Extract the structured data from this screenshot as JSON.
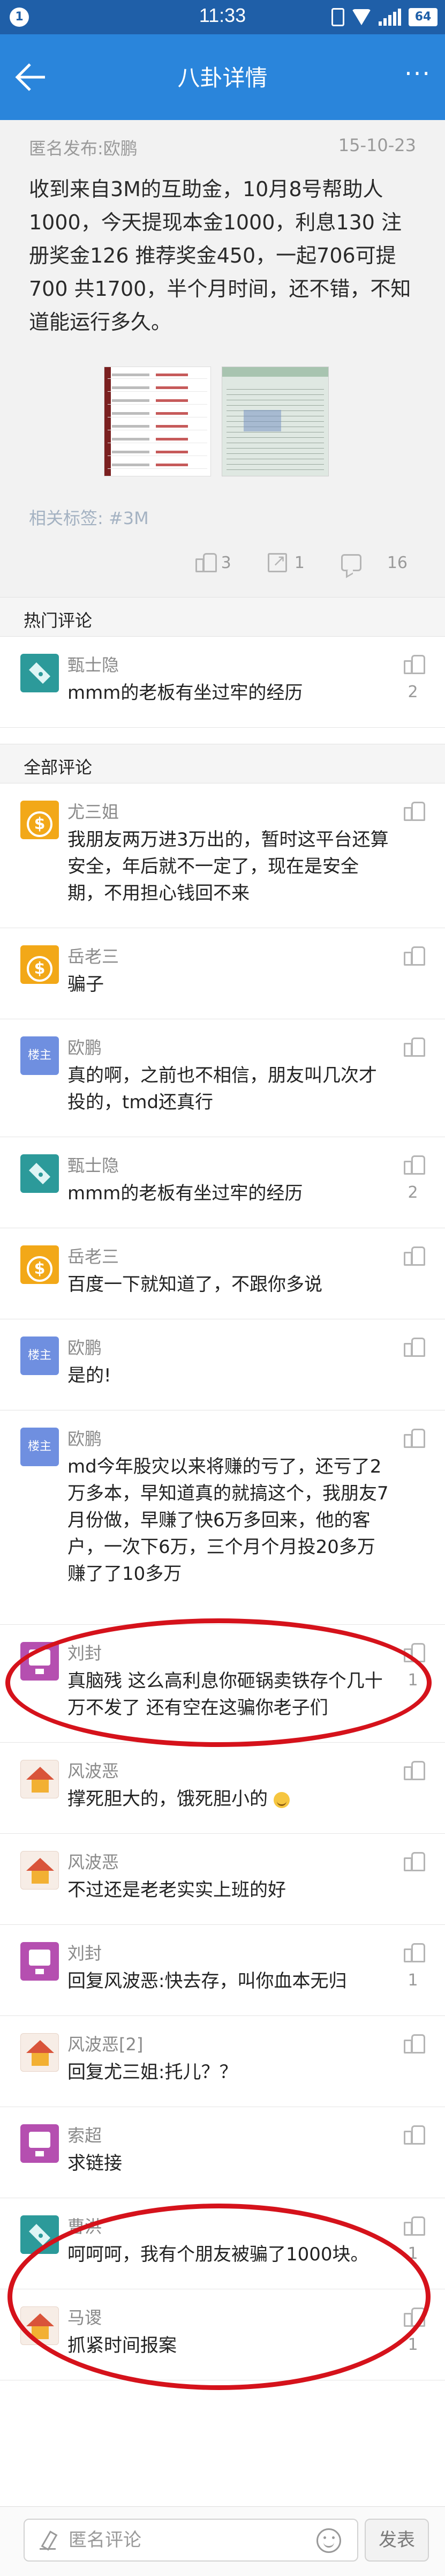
{
  "status_bar": {
    "notification_badge": "1",
    "time": "11:33",
    "battery": "64"
  },
  "header": {
    "title": "八卦详情"
  },
  "post": {
    "author": "匿名发布:欧鹏",
    "date": "15-10-23",
    "body": "收到来自3M的互助金，10月8号帮助人1000，今天提现本金1000，利息130 注册奖金126 推荐奖金450，一起706可提700 共1700，半个月时间，还不错，不知道能运行多久。",
    "tags": "相关标签: #3M",
    "likes": "3",
    "shares": "1",
    "comments": "16"
  },
  "hot_section": {
    "title": "热门评论"
  },
  "all_section": {
    "title": "全部评论"
  },
  "hot_comments": [
    {
      "name": "甄士隐",
      "avatar": "cyan-pinwheel",
      "text": "mmm的老板有坐过牢的经历",
      "likes": "2"
    }
  ],
  "comments": [
    {
      "name": "尤三姐",
      "avatar": "gold-coin",
      "avatar_glyph": "$",
      "text": "我朋友两万进3万出的，暂时这平台还算安全，年后就不一定了，现在是安全期，不用担心钱回不来",
      "likes": ""
    },
    {
      "name": "岳老三",
      "avatar": "gold-coin",
      "avatar_glyph": "$",
      "text": "骗子",
      "likes": ""
    },
    {
      "name": "欧鹏",
      "avatar": "blue-owner",
      "avatar_glyph": "楼主",
      "text": "真的啊，之前也不相信，朋友叫几次才投的，tmd还真行",
      "likes": ""
    },
    {
      "name": "甄士隐",
      "avatar": "cyan-pinwheel",
      "text": "mmm的老板有坐过牢的经历",
      "likes": "2"
    },
    {
      "name": "岳老三",
      "avatar": "gold-coin",
      "avatar_glyph": "$",
      "text": "百度一下就知道了，不跟你多说",
      "likes": ""
    },
    {
      "name": "欧鹏",
      "avatar": "blue-owner",
      "avatar_glyph": "楼主",
      "text": "是的!",
      "likes": ""
    },
    {
      "name": "欧鹏",
      "avatar": "blue-owner",
      "avatar_glyph": "楼主",
      "text": "md今年股灾以来将赚的亏了，还亏了2万多本，早知道真的就搞这个，我朋友7月份做，早赚了快6万多回来，他的客户，一次下6万，三个月个月投20多万赚了了10多万",
      "likes": ""
    },
    {
      "name": "刘封",
      "avatar": "purple-tv",
      "text": "真脑残 这么高利息你砸锅卖铁存个几十万不发了 还有空在这骗你老子们",
      "likes": "1"
    },
    {
      "name": "风波恶",
      "avatar": "house",
      "text": "撑死胆大的，饿死胆小的",
      "likes": ""
    },
    {
      "name": "风波恶",
      "avatar": "house",
      "text": "不过还是老老实实上班的好",
      "likes": ""
    },
    {
      "name": "刘封",
      "avatar": "purple-tv",
      "text": "回复风波恶:快去存，叫你血本无归",
      "likes": "1"
    },
    {
      "name": "风波恶[2]",
      "avatar": "house",
      "text": "回复尤三姐:托儿？？",
      "likes": ""
    },
    {
      "name": "索超",
      "avatar": "purple-tv",
      "text": "求链接",
      "likes": ""
    },
    {
      "name": "曹洪",
      "avatar": "cyan-pinwheel",
      "text": "呵呵呵，我有个朋友被骗了1000块。",
      "likes": "1"
    },
    {
      "name": "马谡",
      "avatar": "house",
      "text": "抓紧时间报案",
      "likes": "1"
    }
  ],
  "bottom_bar": {
    "input_placeholder": "匿名评论",
    "send_label": "发表"
  },
  "colors": {
    "status_bar": "#1f5fa8",
    "nav_bar": "#2a85db",
    "annotation_ellipse": "#d5121b"
  }
}
